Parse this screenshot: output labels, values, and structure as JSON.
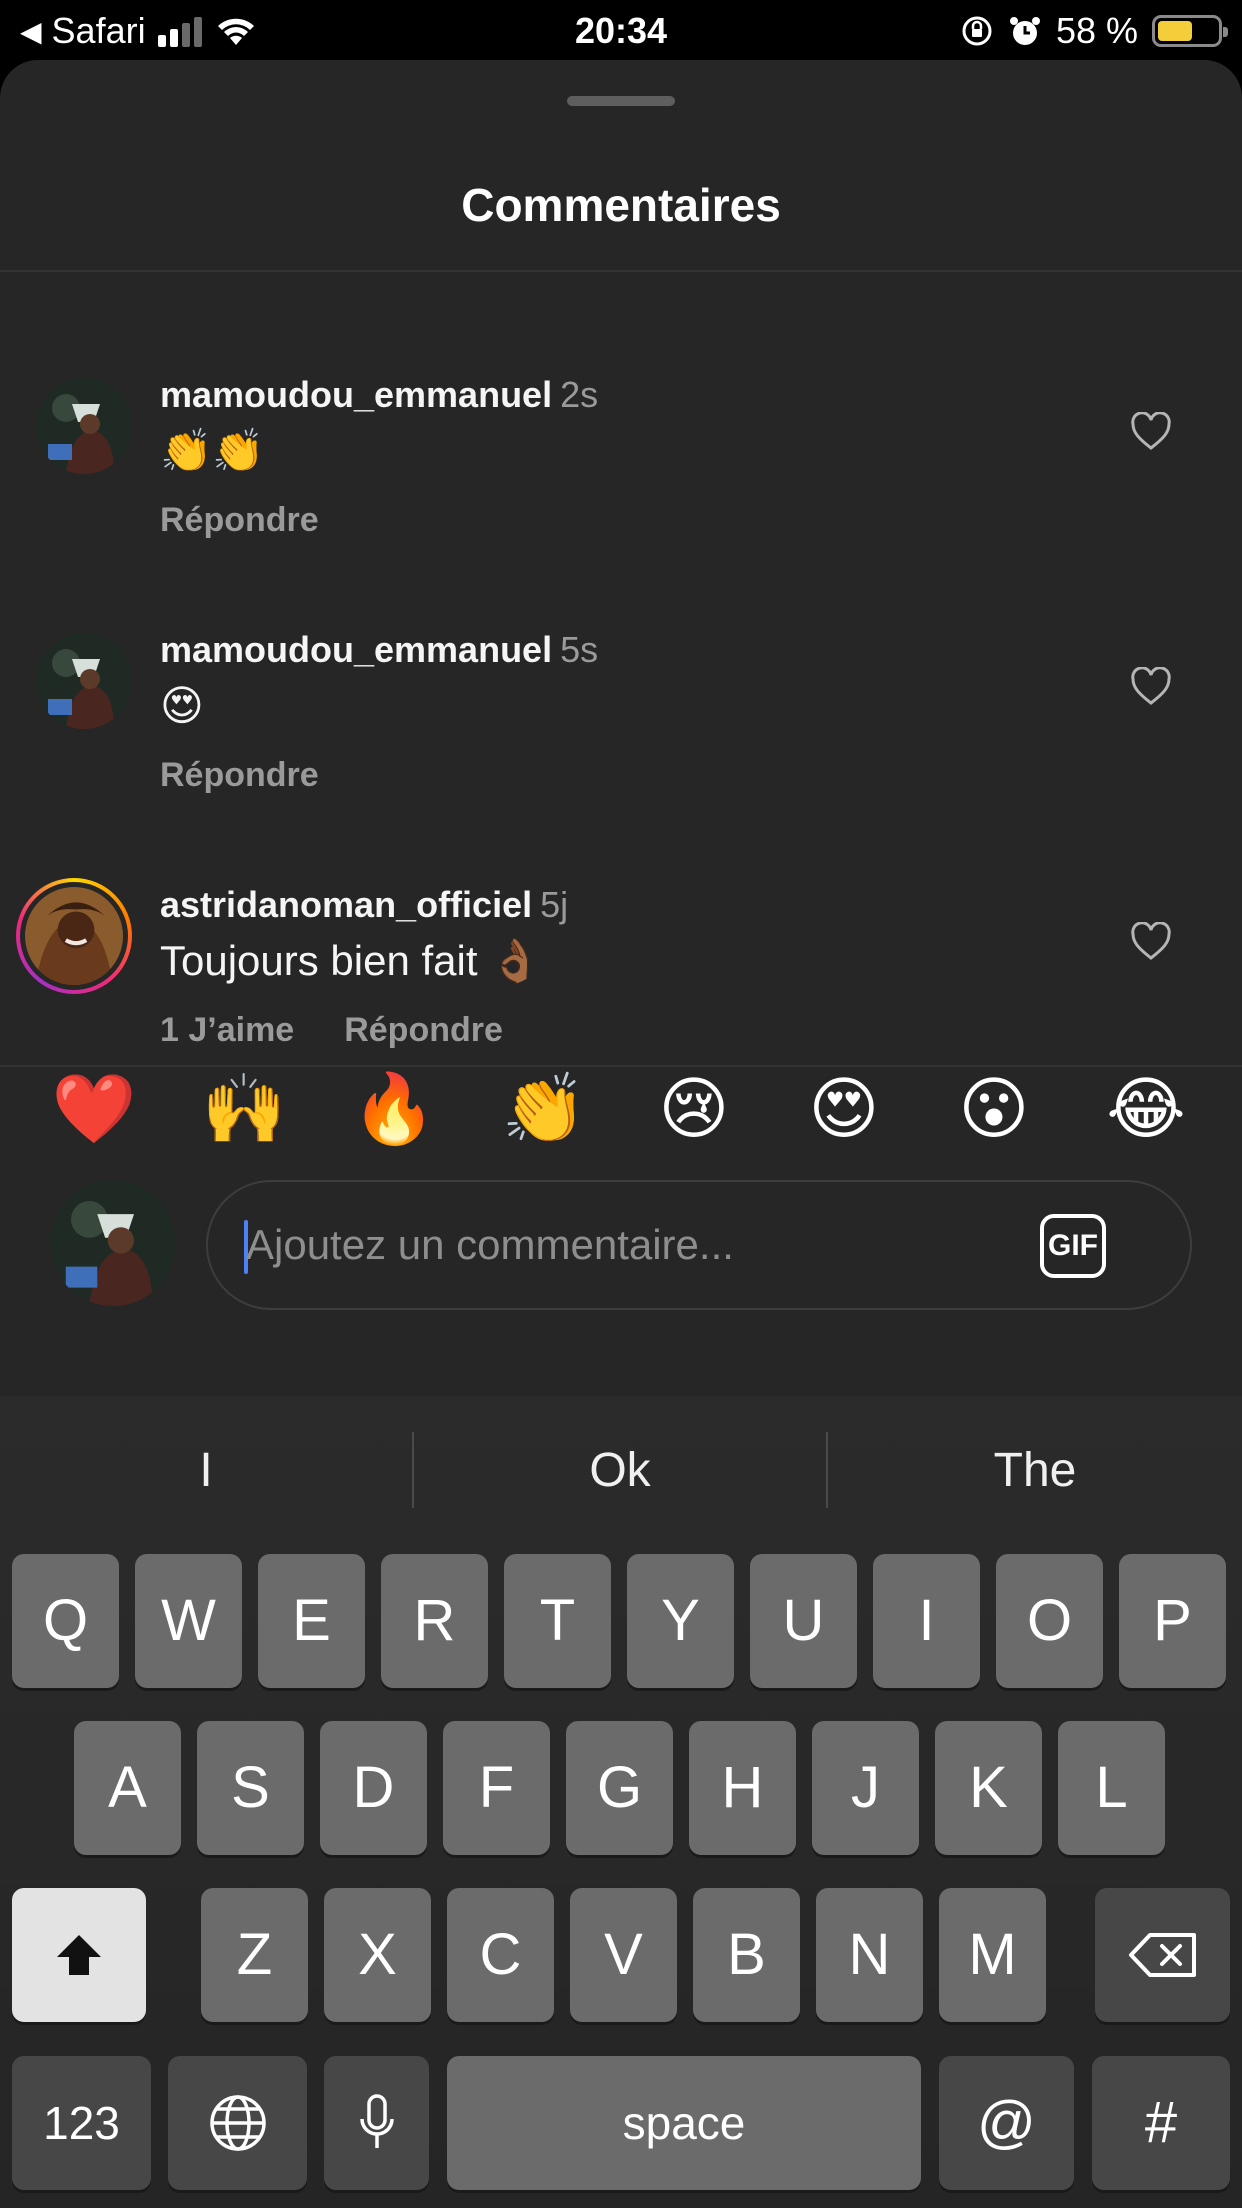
{
  "status_bar": {
    "back_app": "Safari",
    "time": "20:34",
    "battery": "58 %",
    "battery_level": 0.58
  },
  "sheet": {
    "title": "Commentaires"
  },
  "comments": [
    {
      "username": "mamoudou_emmanuel",
      "time": "2s",
      "text": "👏👏",
      "reply": "Répondre",
      "likes": ""
    },
    {
      "username": "mamoudou_emmanuel",
      "time": "5s",
      "text": "😍",
      "reply": "Répondre",
      "likes": ""
    },
    {
      "username": "astridanoman_officiel",
      "time": "5j",
      "text": "Toujours bien fait 👌🏾",
      "reply": "Répondre",
      "likes": "1 J’aime"
    }
  ],
  "reactions": [
    "❤️",
    "🙌",
    "🔥",
    "👏",
    "😢",
    "😍",
    "😮",
    "😂"
  ],
  "composer": {
    "placeholder": "Ajoutez un commentaire...",
    "gif_label": "GIF"
  },
  "keyboard": {
    "suggestions": [
      "I",
      "Ok",
      "The"
    ],
    "row1": [
      "Q",
      "W",
      "E",
      "R",
      "T",
      "Y",
      "U",
      "I",
      "O",
      "P"
    ],
    "row2": [
      "A",
      "S",
      "D",
      "F",
      "G",
      "H",
      "J",
      "K",
      "L"
    ],
    "row3": [
      "Z",
      "X",
      "C",
      "V",
      "B",
      "N",
      "M"
    ],
    "numbers_label": "123",
    "space_label": "space",
    "at_label": "@",
    "hash_label": "#"
  },
  "colors": {
    "sheet_bg": "#262626",
    "caret": "#4c82f7",
    "battery": "#f4cd3a"
  }
}
